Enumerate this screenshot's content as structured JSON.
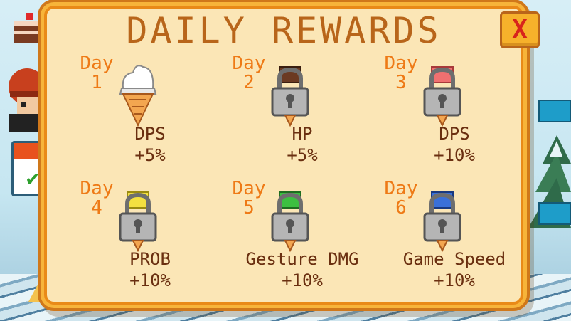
{
  "dialog": {
    "title": "DAILY REWARDS",
    "close_label": "X"
  },
  "rewards": [
    {
      "day": "Day\n1",
      "stat": "DPS",
      "bonus": "+5%",
      "locked": false,
      "scoop_color": "#ffffff"
    },
    {
      "day": "Day\n2",
      "stat": "HP",
      "bonus": "+5%",
      "locked": true,
      "scoop_color": "#6b3a22"
    },
    {
      "day": "Day\n3",
      "stat": "DPS",
      "bonus": "+10%",
      "locked": true,
      "scoop_color": "#f07070"
    },
    {
      "day": "Day\n4",
      "stat": "PROB",
      "bonus": "+10%",
      "locked": true,
      "scoop_color": "#f4e040"
    },
    {
      "day": "Day\n5",
      "stat": "Gesture DMG",
      "bonus": "+10%",
      "locked": true,
      "scoop_color": "#3cc040"
    },
    {
      "day": "Day\n6",
      "stat": "Game Speed",
      "bonus": "+10%",
      "locked": true,
      "scoop_color": "#3a70d8"
    }
  ],
  "colors": {
    "panel_bg": "#fbe6b6",
    "panel_border": "#e98a18",
    "title": "#b8651a",
    "day_label": "#ee7a16",
    "stat_text": "#6a2f10",
    "close_x": "#d8241c"
  },
  "icons": {
    "close": "close-icon",
    "locked": "padlock-icon",
    "unlocked": "ice-cream-cone-icon"
  }
}
